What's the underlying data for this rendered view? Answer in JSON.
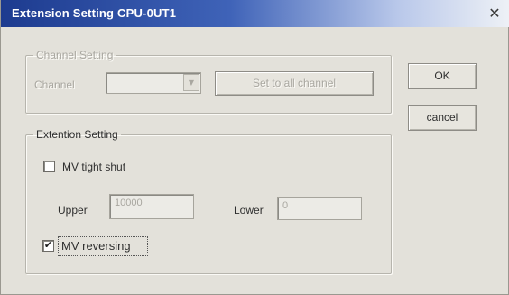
{
  "window": {
    "title": "Extension Setting CPU-0UT1",
    "close_glyph": "✕"
  },
  "channel_group": {
    "legend": "Channel Setting",
    "channel_label": "Channel",
    "channel_value": "",
    "set_all_button": "Set to all channel"
  },
  "extention_group": {
    "legend": "Extention Setting",
    "tight_shut_label": "MV tight shut",
    "tight_shut_checked": false,
    "upper_label": "Upper",
    "upper_value": "10000",
    "lower_label": "Lower",
    "lower_value": "0",
    "reversing_label": "MV reversing",
    "reversing_checked": true
  },
  "buttons": {
    "ok": "OK",
    "cancel": "cancel"
  },
  "icons": {
    "close": "close-icon",
    "dropdown": "chevron-down-icon",
    "check": "checkmark-icon"
  },
  "colors": {
    "title_bar_start": "#1d3b8f",
    "dialog_background": "#e3e1da",
    "disabled_text": "#a9a7a0"
  }
}
